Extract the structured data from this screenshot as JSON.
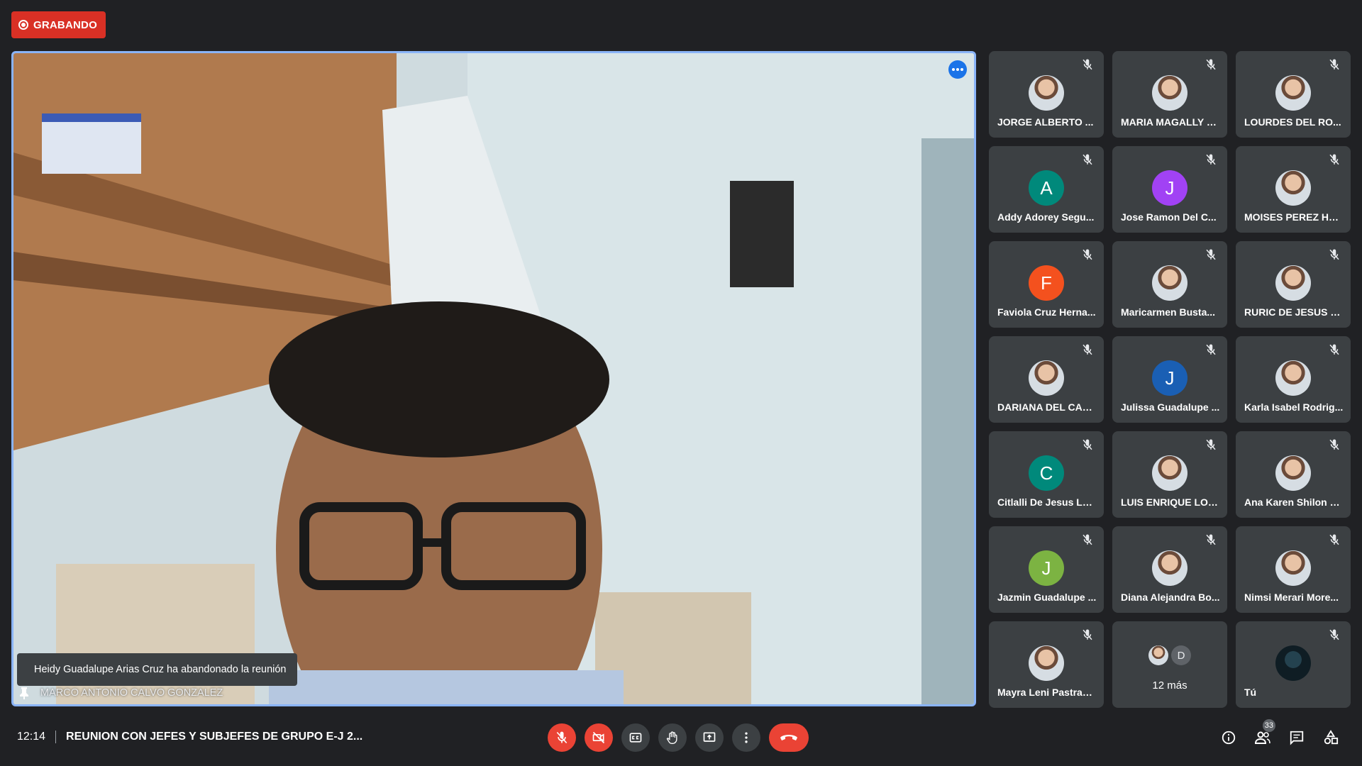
{
  "recording": {
    "label": "GRABANDO",
    "color": "#d93025"
  },
  "main_video": {
    "speaker_name": "MARCO ANTONIO CALVO GONZALEZ",
    "notification": "Heidy Guadalupe Arias Cruz ha abandonado la reunión",
    "options_icon": "more-horiz-icon"
  },
  "participants": [
    {
      "name": "JORGE ALBERTO ...",
      "avatar": "photo"
    },
    {
      "name": "MARIA MAGALLY V...",
      "avatar": "photo"
    },
    {
      "name": "LOURDES DEL RO...",
      "avatar": "photo"
    },
    {
      "name": "Addy Adorey Segu...",
      "avatar": "A",
      "color": "#00897b"
    },
    {
      "name": "Jose Ramon Del C...",
      "avatar": "J",
      "color": "#a142f4"
    },
    {
      "name": "MOISES PEREZ HE...",
      "avatar": "photo"
    },
    {
      "name": "Faviola Cruz Herna...",
      "avatar": "F",
      "color": "#f4511e"
    },
    {
      "name": "Maricarmen Busta...",
      "avatar": "photo"
    },
    {
      "name": "RURIC DE JESUS G...",
      "avatar": "photo"
    },
    {
      "name": "DARIANA DEL CAR...",
      "avatar": "photo"
    },
    {
      "name": "Julissa Guadalupe ...",
      "avatar": "J",
      "color": "#1a5fb4"
    },
    {
      "name": "Karla Isabel Rodrig...",
      "avatar": "photo"
    },
    {
      "name": "Citlalli De Jesus Lo...",
      "avatar": "C",
      "color": "#00897b"
    },
    {
      "name": "LUIS ENRIQUE LOP...",
      "avatar": "photo"
    },
    {
      "name": "Ana Karen Shilon Ji...",
      "avatar": "photo"
    },
    {
      "name": "Jazmin Guadalupe ...",
      "avatar": "J",
      "color": "#7cb342"
    },
    {
      "name": "Diana Alejandra Bo...",
      "avatar": "photo"
    },
    {
      "name": "Nimsi Merari More...",
      "avatar": "photo"
    },
    {
      "name": "Mayra Leni Pastran...",
      "avatar": "photo"
    }
  ],
  "more_tile": {
    "label": "12 más",
    "initial": "D"
  },
  "self_tile": {
    "name": "Tú"
  },
  "bottom_bar": {
    "time": "12:14",
    "meeting_title": "REUNION CON JEFES Y SUBJEFES DE GRUPO E-J 2...",
    "people_count": "33"
  }
}
